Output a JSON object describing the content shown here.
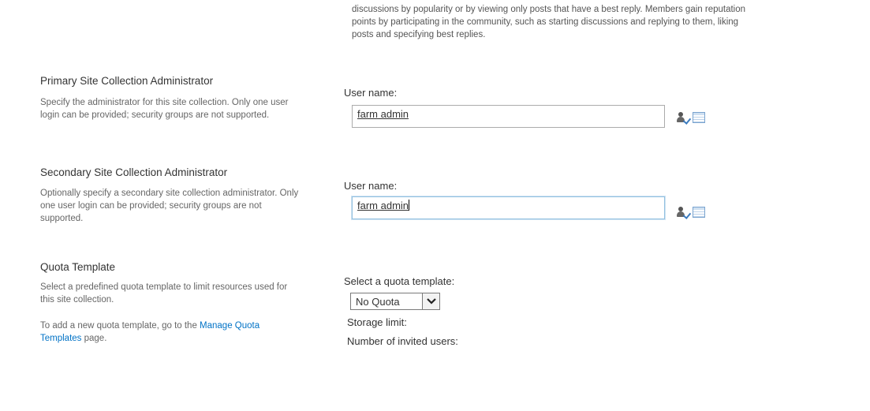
{
  "community": {
    "description": "discussions by popularity or by viewing only posts that have a best reply. Members gain reputation points by participating in the community, such as starting discussions and replying to them, liking posts and specifying best replies."
  },
  "primary_admin": {
    "title": "Primary Site Collection Administrator",
    "description": "Specify the administrator for this site collection. Only one user login can be provided; security groups are not supported.",
    "field_label": "User name:",
    "value": "farm admin",
    "check_icon": "check-names-icon",
    "browse_icon": "browse-address-book-icon"
  },
  "secondary_admin": {
    "title": "Secondary Site Collection Administrator",
    "description": "Optionally specify a secondary site collection administrator. Only one user login can be provided; security groups are not supported.",
    "field_label": "User name:",
    "value": "farm admin",
    "check_icon": "check-names-icon",
    "browse_icon": "browse-address-book-icon"
  },
  "quota": {
    "title": "Quota Template",
    "description": "Select a predefined quota template to limit resources used for this site collection.",
    "link_prefix": "To add a new quota template, go to the ",
    "link_text": "Manage Quota Templates",
    "link_suffix": " page.",
    "select_label": "Select a quota template:",
    "selected_value": "No Quota",
    "storage_limit_label": "Storage limit:",
    "invited_users_label": "Number of invited users:"
  },
  "colors": {
    "link": "#0072c6",
    "focus_border": "#92c0e0"
  }
}
